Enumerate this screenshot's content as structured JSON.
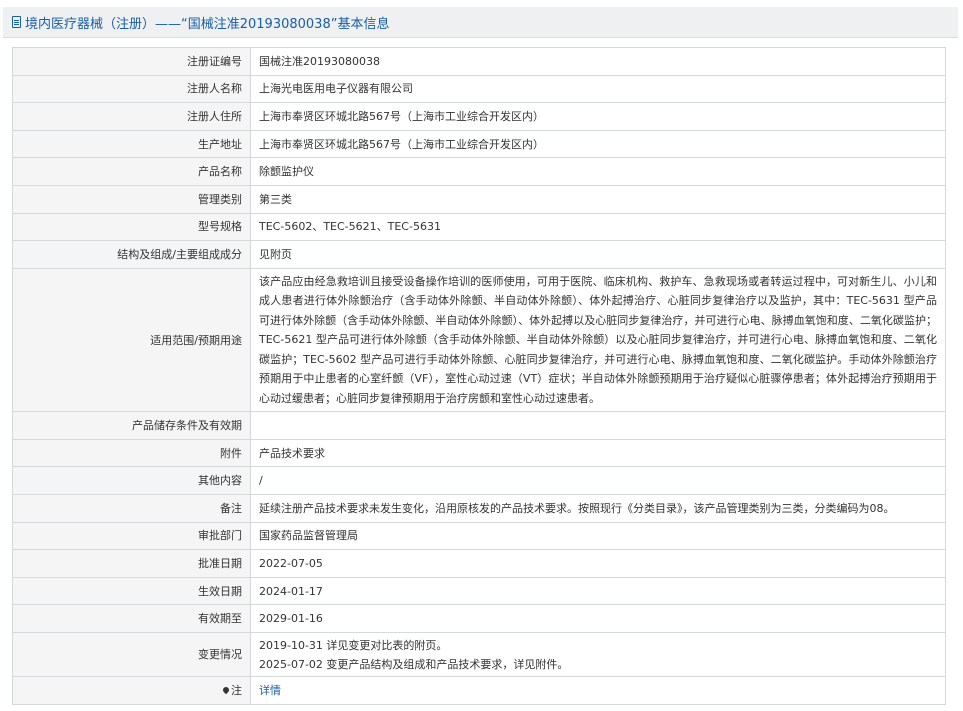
{
  "header": {
    "icon": "document-icon",
    "title": "境内医疗器械（注册）——“国械注准20193080038”基本信息"
  },
  "rows": [
    {
      "label": "注册证编号",
      "value": "国械注准20193080038"
    },
    {
      "label": "注册人名称",
      "value": "上海光电医用电子仪器有限公司"
    },
    {
      "label": "注册人住所",
      "value": "上海市奉贤区环城北路567号（上海市工业综合开发区内）"
    },
    {
      "label": "生产地址",
      "value": "上海市奉贤区环城北路567号（上海市工业综合开发区内）"
    },
    {
      "label": "产品名称",
      "value": "除颤监护仪"
    },
    {
      "label": "管理类别",
      "value": "第三类"
    },
    {
      "label": "型号规格",
      "value": "TEC-5602、TEC-5621、TEC-5631"
    },
    {
      "label": "结构及组成/主要组成成分",
      "value": "见附页"
    },
    {
      "label": "适用范围/预期用途",
      "value": "该产品应由经急救培训且接受设备操作培训的医师使用，可用于医院、临床机构、救护车、急救现场或者转运过程中，可对新生儿、小儿和成人患者进行体外除颤治疗（含手动体外除颤、半自动体外除颤）、体外起搏治疗、心脏同步复律治疗以及监护，其中：TEC-5631 型产品可进行体外除颤（含手动体外除颤、半自动体外除颤）、体外起搏以及心脏同步复律治疗，并可进行心电、脉搏血氧饱和度、二氧化碳监护；TEC-5621 型产品可进行体外除颤（含手动体外除颤、半自动体外除颤）以及心脏同步复律治疗，并可进行心电、脉搏血氧饱和度、二氧化碳监护；TEC-5602 型产品可进行手动体外除颤、心脏同步复律治疗，并可进行心电、脉搏血氧饱和度、二氧化碳监护。手动体外除颤治疗预期用于中止患者的心室纤颤（VF），室性心动过速（VT）症状；半自动体外除颤预期用于治疗疑似心脏骤停患者；体外起搏治疗预期用于心动过缓患者；心脏同步复律预期用于治疗房颤和室性心动过速患者。"
    },
    {
      "label": "产品储存条件及有效期",
      "value": ""
    },
    {
      "label": "附件",
      "value": "产品技术要求"
    },
    {
      "label": "其他内容",
      "value": "/"
    },
    {
      "label": "备注",
      "value": "延续注册产品技术要求未发生变化，沿用原核发的产品技术要求。按照现行《分类目录》，该产品管理类别为三类，分类编码为08。"
    },
    {
      "label": "审批部门",
      "value": "国家药品监督管理局"
    },
    {
      "label": "批准日期",
      "value": "2022-07-05"
    },
    {
      "label": "生效日期",
      "value": "2024-01-17"
    },
    {
      "label": "有效期至",
      "value": "2029-01-16"
    }
  ],
  "change": {
    "label": "变更情况",
    "lines": [
      "2019-10-31 详见变更对比表的附页。",
      "2025-07-02 变更产品结构及组成和产品技术要求，详见附件。"
    ]
  },
  "note": {
    "icon": "pin-icon",
    "label": "注",
    "link_text": "详情"
  },
  "colors": {
    "accent": "#1a5ea5",
    "label_bg": "#f5f5f5",
    "border": "#d6d9dc",
    "header_bg": "#eef0f2"
  }
}
